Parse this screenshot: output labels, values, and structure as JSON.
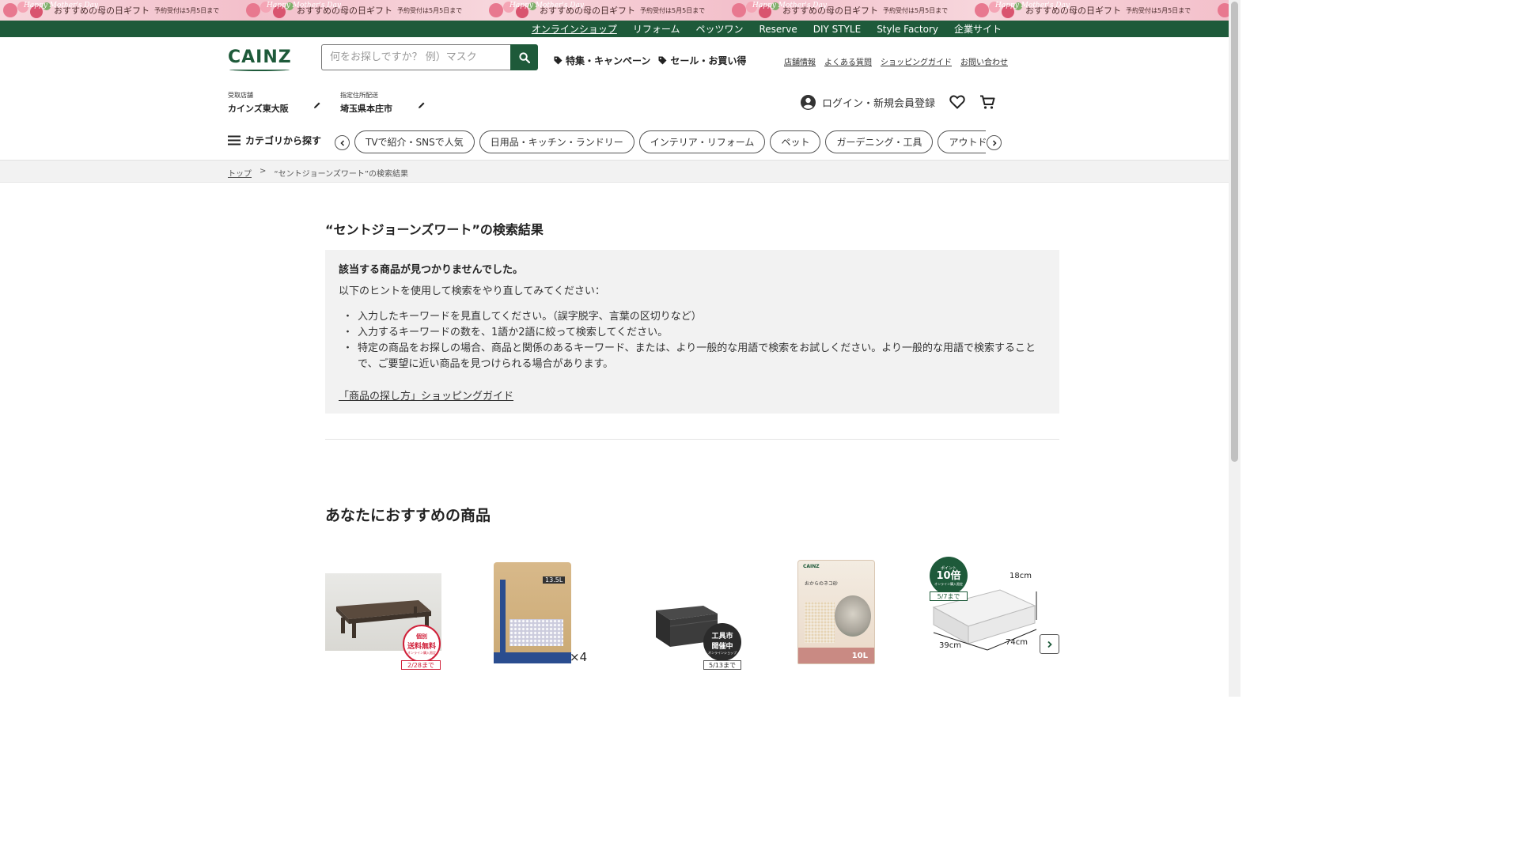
{
  "promo": {
    "mark": "Happy Mother's Day",
    "text": "おすすめの母の日ギフト",
    "subtext": "予約受付は5月5日まで"
  },
  "topnav": {
    "items": [
      "オンラインショップ",
      "リフォーム",
      "ペッツワン",
      "Reserve",
      "DIY STYLE",
      "Style Factory",
      "企業サイト"
    ]
  },
  "header": {
    "logo": "CAINZ",
    "search_placeholder": "何をお探しですか？ 例）マスク",
    "tags": [
      "特集・キャンペーン",
      "セール・お買い得"
    ],
    "util_links": [
      "店舗情報",
      "よくある質問",
      "ショッピングガイド",
      "お問い合わせ"
    ],
    "pickup_store_label": "受取店舗",
    "pickup_store_value": "カインズ東大阪",
    "delivery_label": "指定住所配送",
    "delivery_value": "埼玉県本庄市",
    "login_label": "ログイン・新規会員登録"
  },
  "categories": {
    "menu_label": "カテゴリから探す",
    "pills": [
      "TVで紹介・SNSで人気",
      "日用品・キッチン・ランドリー",
      "インテリア・リフォーム",
      "ペット",
      "ガーデニング・工具",
      "アウトドア・カー用品"
    ]
  },
  "breadcrumb": {
    "home": "トップ",
    "separator": ">",
    "current": "“セントジョーンズワート”の検索結果"
  },
  "results": {
    "title": "“セントジョーンズワート”の検索結果",
    "not_found": "該当する商品が見つかりませんでした。",
    "intro": "以下のヒントを使用して検索をやり直してみてください：",
    "hints": [
      "入力したキーワードを見直してください。（誤字脱字、言葉の区切りなど）",
      "入力するキーワードの数を、1語か2語に絞って検索してください。",
      "特定の商品をお探しの場合、商品と関係のあるキーワード、または、より一般的な用語で検索をお試しください。より一般的な用語で検索することで、ご要望に近い商品を見つけられる場合があります。"
    ],
    "guide_link": "「商品の探し方」ショッピングガイド"
  },
  "recommend": {
    "title": "あなたにおすすめの商品",
    "products": [
      {
        "badge_line1": "個別",
        "badge_line2": "送料無料",
        "badge_line3": "オンライン購入限定",
        "ribbon": "2/28まで"
      },
      {
        "multiplier": "×4",
        "bag_size": "13.5L"
      },
      {
        "badge_line1": "工具市",
        "badge_line2": "開催中",
        "badge_line3": "オンラインショップ",
        "ribbon": "5/13まで"
      },
      {
        "bag_brand": "CAINZ",
        "bag_label": "おからのネコ砂",
        "bag_size": "10L"
      },
      {
        "badge_line1": "ポイント",
        "badge_line2": "10倍",
        "badge_line3": "オンライン購入限定",
        "ribbon": "5/7まで",
        "dim_height": "18cm",
        "dim_width": "39cm",
        "dim_depth": "74cm"
      }
    ]
  },
  "colors": {
    "brand_green": "#1e5a3a",
    "hint_bg": "#f2f2f2",
    "badge_red": "#d0213a"
  }
}
